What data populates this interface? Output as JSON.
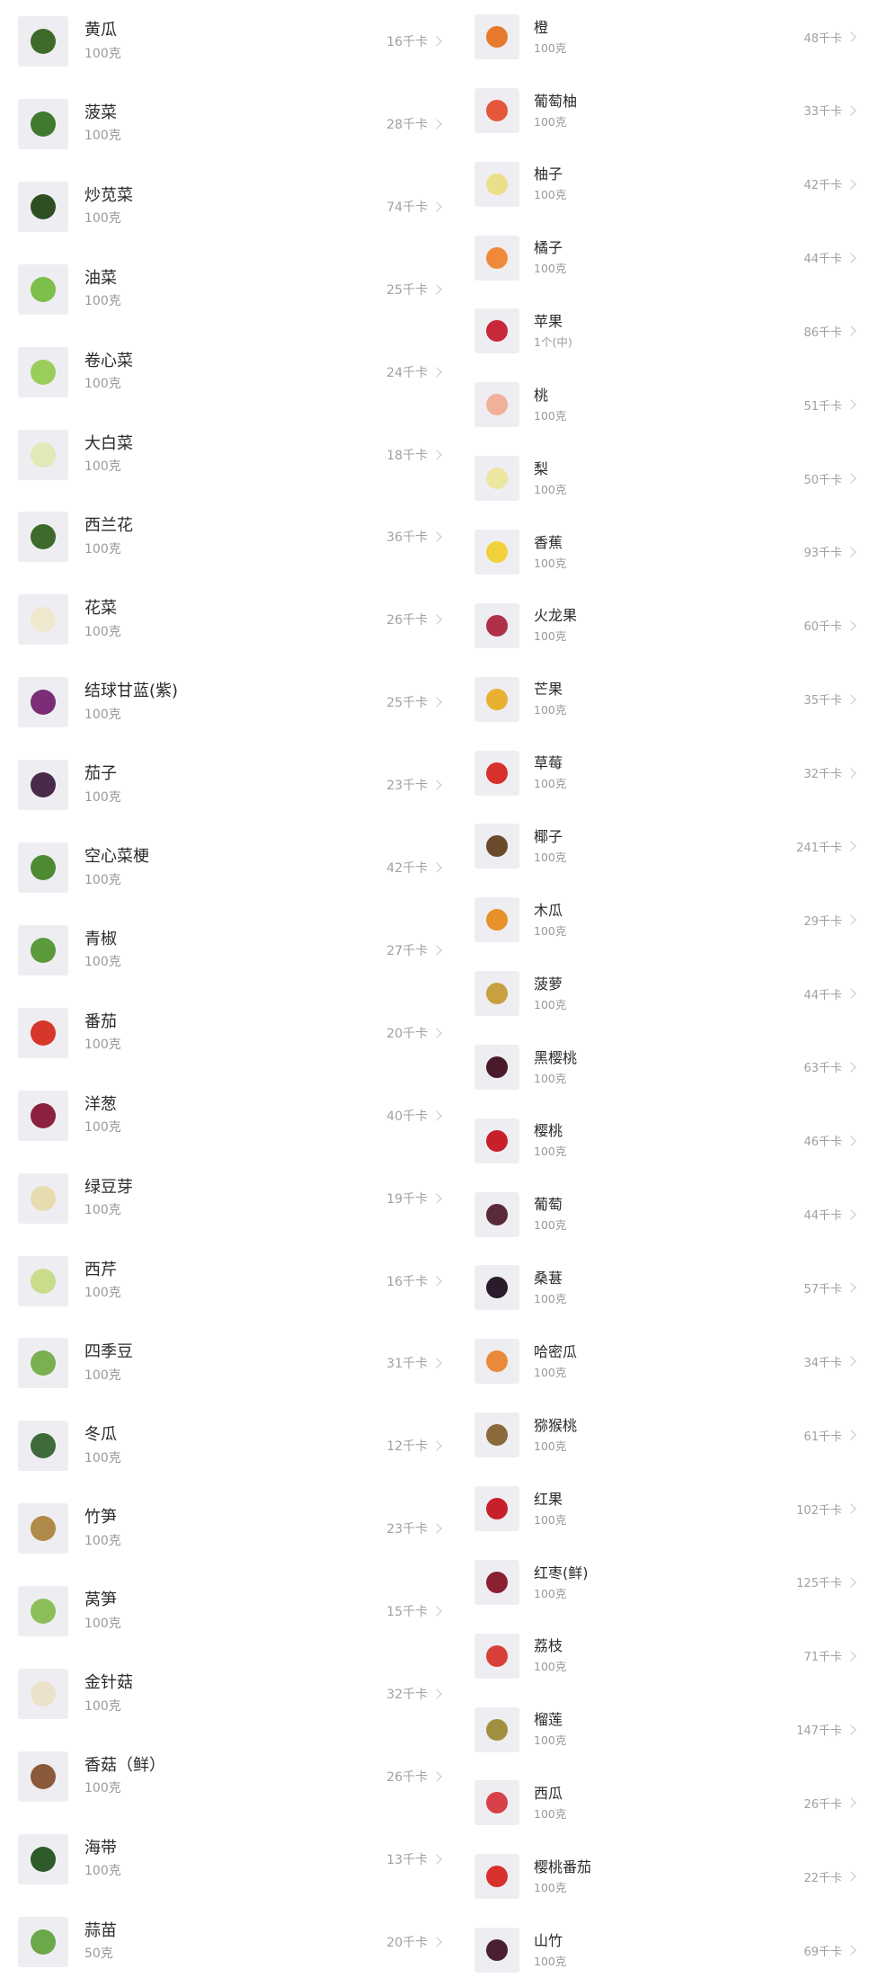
{
  "kcal_unit": "千卡",
  "left_items": [
    {
      "name": "黄瓜",
      "amount": "100克",
      "kcal": "16",
      "icon": "cucumber-icon",
      "color": "#3f6b2a"
    },
    {
      "name": "菠菜",
      "amount": "100克",
      "kcal": "28",
      "icon": "spinach-icon",
      "color": "#3f7a2e"
    },
    {
      "name": "炒苋菜",
      "amount": "100克",
      "kcal": "74",
      "icon": "amaranth-icon",
      "color": "#2f4f22"
    },
    {
      "name": "油菜",
      "amount": "100克",
      "kcal": "25",
      "icon": "bok-choy-icon",
      "color": "#7cbf4a"
    },
    {
      "name": "卷心菜",
      "amount": "100克",
      "kcal": "24",
      "icon": "cabbage-icon",
      "color": "#9acd5a"
    },
    {
      "name": "大白菜",
      "amount": "100克",
      "kcal": "18",
      "icon": "napa-cabbage-icon",
      "color": "#e3e8b8"
    },
    {
      "name": "西兰花",
      "amount": "100克",
      "kcal": "36",
      "icon": "broccoli-icon",
      "color": "#3e6b2b"
    },
    {
      "name": "花菜",
      "amount": "100克",
      "kcal": "26",
      "icon": "cauliflower-icon",
      "color": "#efe8cf"
    },
    {
      "name": "结球甘蓝(紫)",
      "amount": "100克",
      "kcal": "25",
      "icon": "red-cabbage-icon",
      "color": "#7b2e77"
    },
    {
      "name": "茄子",
      "amount": "100克",
      "kcal": "23",
      "icon": "eggplant-icon",
      "color": "#4a2a4a"
    },
    {
      "name": "空心菜梗",
      "amount": "100克",
      "kcal": "42",
      "icon": "water-spinach-icon",
      "color": "#4e8a34"
    },
    {
      "name": "青椒",
      "amount": "100克",
      "kcal": "27",
      "icon": "green-pepper-icon",
      "color": "#5a9a3a"
    },
    {
      "name": "番茄",
      "amount": "100克",
      "kcal": "20",
      "icon": "tomato-icon",
      "color": "#d8362b"
    },
    {
      "name": "洋葱",
      "amount": "100克",
      "kcal": "40",
      "icon": "onion-icon",
      "color": "#8b2040"
    },
    {
      "name": "绿豆芽",
      "amount": "100克",
      "kcal": "19",
      "icon": "bean-sprouts-icon",
      "color": "#e6dcb0"
    },
    {
      "name": "西芹",
      "amount": "100克",
      "kcal": "16",
      "icon": "celery-icon",
      "color": "#c9dc8a"
    },
    {
      "name": "四季豆",
      "amount": "100克",
      "kcal": "31",
      "icon": "green-beans-icon",
      "color": "#7ab050"
    },
    {
      "name": "冬瓜",
      "amount": "100克",
      "kcal": "12",
      "icon": "winter-melon-icon",
      "color": "#3f6a3a"
    },
    {
      "name": "竹笋",
      "amount": "100克",
      "kcal": "23",
      "icon": "bamboo-shoot-icon",
      "color": "#b08a4a"
    },
    {
      "name": "莴笋",
      "amount": "100克",
      "kcal": "15",
      "icon": "lettuce-stem-icon",
      "color": "#8cbf5a"
    },
    {
      "name": "金针菇",
      "amount": "100克",
      "kcal": "32",
      "icon": "enoki-icon",
      "color": "#ece2cc"
    },
    {
      "name": "香菇（鲜）",
      "amount": "100克",
      "kcal": "26",
      "icon": "shiitake-icon",
      "color": "#8a5a3a"
    },
    {
      "name": "海带",
      "amount": "100克",
      "kcal": "13",
      "icon": "kelp-icon",
      "color": "#2f5a2a"
    },
    {
      "name": "蒜苗",
      "amount": "50克",
      "kcal": "20",
      "icon": "garlic-sprout-icon",
      "color": "#6aa84a"
    }
  ],
  "right_items": [
    {
      "name": "橙",
      "amount": "100克",
      "kcal": "48",
      "icon": "orange-icon",
      "color": "#e77a2a"
    },
    {
      "name": "葡萄柚",
      "amount": "100克",
      "kcal": "33",
      "icon": "grapefruit-icon",
      "color": "#e4573a"
    },
    {
      "name": "柚子",
      "amount": "100克",
      "kcal": "42",
      "icon": "pomelo-icon",
      "color": "#eadf8a"
    },
    {
      "name": "橘子",
      "amount": "100克",
      "kcal": "44",
      "icon": "tangerine-icon",
      "color": "#ef8a3a"
    },
    {
      "name": "苹果",
      "amount": "1个(中)",
      "kcal": "86",
      "icon": "apple-icon",
      "color": "#c8283a"
    },
    {
      "name": "桃",
      "amount": "100克",
      "kcal": "51",
      "icon": "peach-icon",
      "color": "#f0b09a"
    },
    {
      "name": "梨",
      "amount": "100克",
      "kcal": "50",
      "icon": "pear-icon",
      "color": "#ece7a0"
    },
    {
      "name": "香蕉",
      "amount": "100克",
      "kcal": "93",
      "icon": "banana-icon",
      "color": "#f2d23a"
    },
    {
      "name": "火龙果",
      "amount": "100克",
      "kcal": "60",
      "icon": "dragon-fruit-icon",
      "color": "#b0304a"
    },
    {
      "name": "芒果",
      "amount": "100克",
      "kcal": "35",
      "icon": "mango-icon",
      "color": "#e8b030"
    },
    {
      "name": "草莓",
      "amount": "100克",
      "kcal": "32",
      "icon": "strawberry-icon",
      "color": "#d8302a"
    },
    {
      "name": "椰子",
      "amount": "100克",
      "kcal": "241",
      "icon": "coconut-icon",
      "color": "#6a4a2a"
    },
    {
      "name": "木瓜",
      "amount": "100克",
      "kcal": "29",
      "icon": "papaya-icon",
      "color": "#e8902a"
    },
    {
      "name": "菠萝",
      "amount": "100克",
      "kcal": "44",
      "icon": "pineapple-icon",
      "color": "#c9a040"
    },
    {
      "name": "黑樱桃",
      "amount": "100克",
      "kcal": "63",
      "icon": "black-cherry-icon",
      "color": "#4a1a2a"
    },
    {
      "name": "樱桃",
      "amount": "100克",
      "kcal": "46",
      "icon": "cherry-icon",
      "color": "#c8202a"
    },
    {
      "name": "葡萄",
      "amount": "100克",
      "kcal": "44",
      "icon": "grape-icon",
      "color": "#5a2a3a"
    },
    {
      "name": "桑葚",
      "amount": "100克",
      "kcal": "57",
      "icon": "mulberry-icon",
      "color": "#2a1a2a"
    },
    {
      "name": "哈密瓜",
      "amount": "100克",
      "kcal": "34",
      "icon": "hami-melon-icon",
      "color": "#e88a3a"
    },
    {
      "name": "猕猴桃",
      "amount": "100克",
      "kcal": "61",
      "icon": "kiwi-icon",
      "color": "#8a6a3a"
    },
    {
      "name": "红果",
      "amount": "100克",
      "kcal": "102",
      "icon": "hawthorn-icon",
      "color": "#c8202a"
    },
    {
      "name": "红枣(鲜)",
      "amount": "100克",
      "kcal": "125",
      "icon": "jujube-icon",
      "color": "#8a2030"
    },
    {
      "name": "荔枝",
      "amount": "100克",
      "kcal": "71",
      "icon": "lychee-icon",
      "color": "#d8403a"
    },
    {
      "name": "榴莲",
      "amount": "100克",
      "kcal": "147",
      "icon": "durian-icon",
      "color": "#a09040"
    },
    {
      "name": "西瓜",
      "amount": "100克",
      "kcal": "26",
      "icon": "watermelon-icon",
      "color": "#d8404a"
    },
    {
      "name": "樱桃番茄",
      "amount": "100克",
      "kcal": "22",
      "icon": "cherry-tomato-icon",
      "color": "#d8302a"
    },
    {
      "name": "山竹",
      "amount": "100克",
      "kcal": "69",
      "icon": "mangosteen-icon",
      "color": "#4a2030"
    }
  ]
}
